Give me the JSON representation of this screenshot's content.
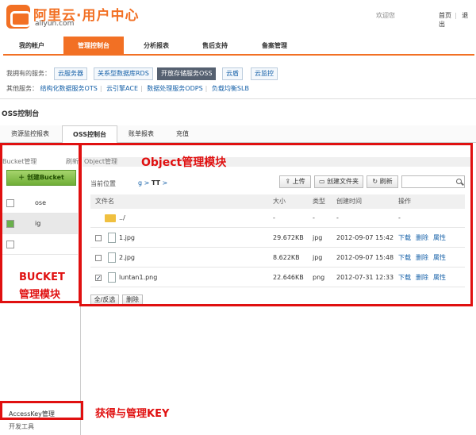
{
  "header": {
    "logo_text": "阿里云·用户中心",
    "logo_sub": "aliyun.com",
    "welcome": "欢迎您",
    "links": [
      "首页",
      "退出"
    ]
  },
  "mainnav": [
    "我的帐户",
    "管理控制台",
    "分析报表",
    "售后支持",
    "备案管理"
  ],
  "services": {
    "label": "我拥有的服务：",
    "owned": [
      "云服务器",
      "关系型数据库RDS",
      "开放存储服务OSS",
      "云盾",
      "云监控"
    ],
    "active": "开放存储服务OSS",
    "other_label": "其他服务：",
    "other": [
      "结构化数据服务OTS",
      "云引擎ACE",
      "数据处理服务ODPS",
      "负载均衡SLB"
    ]
  },
  "console_title": "OSS控制台",
  "subtabs": [
    "资源监控报表",
    "OSS控制台",
    "账单报表",
    "充值"
  ],
  "sidebar": {
    "head": "Bucket管理",
    "refresh": "刷新",
    "create": "创建Bucket",
    "buckets": [
      "ose",
      "ig",
      ""
    ],
    "accesskey": "AccessKey管理",
    "devtools": "开发工具"
  },
  "objects": {
    "head": "Object管理",
    "location_label": "当前位置",
    "path_link": "g",
    "path_current": "TT",
    "buttons": {
      "upload": "上传",
      "mkdir": "创建文件夹",
      "refresh": "刷新"
    },
    "columns": [
      "文件名",
      "大小",
      "类型",
      "创建时间",
      "操作"
    ],
    "rows": [
      {
        "name": "../",
        "size": "-",
        "type": "-",
        "created": "-",
        "op": "-"
      },
      {
        "name": "1.jpg",
        "size": "29.672KB",
        "type": "jpg",
        "created": "2012-09-07 15:42",
        "checked": false
      },
      {
        "name": "2.jpg",
        "size": "8.622KB",
        "type": "jpg",
        "created": "2012-09-07 15:48",
        "checked": false
      },
      {
        "name": "luntan1.png",
        "size": "22.646KB",
        "type": "png",
        "created": "2012-07-31 12:33",
        "checked": true
      }
    ],
    "actions": [
      "下载",
      "删除",
      "属性"
    ],
    "footer": {
      "select_all": "全/反选",
      "delete": "删除"
    }
  },
  "annotations": {
    "object": "Object管理模块",
    "bucket_line1": "BUCKET",
    "bucket_line2": "管理模块",
    "key": "获得与管理KEY",
    "color": "#e01010"
  }
}
